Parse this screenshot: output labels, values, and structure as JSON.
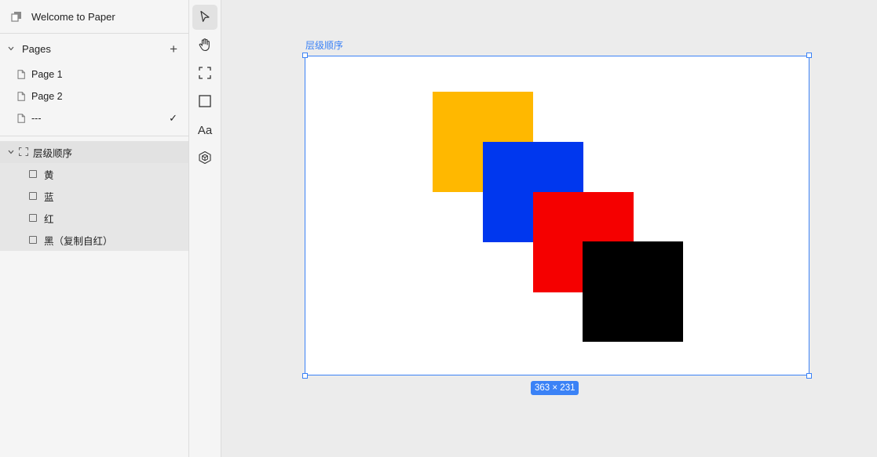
{
  "app": {
    "title": "Welcome to Paper"
  },
  "pages": {
    "header": "Pages",
    "add_icon": "plus-icon",
    "items": [
      {
        "label": "Page 1",
        "current": false
      },
      {
        "label": "Page 2",
        "current": false
      },
      {
        "label": "---",
        "current": true
      }
    ]
  },
  "layers": {
    "frame": {
      "label": "层级顺序"
    },
    "items": [
      {
        "label": "黄"
      },
      {
        "label": "蓝"
      },
      {
        "label": "红"
      },
      {
        "label": "黑（复制自红）"
      }
    ]
  },
  "toolbar": {
    "tools": [
      "pointer-icon",
      "hand-icon",
      "frame-icon",
      "rectangle-icon",
      "text-icon",
      "component-icon"
    ],
    "text_tool_label": "Aa",
    "active_tool": "pointer-icon"
  },
  "canvas": {
    "frame_label": "层级顺序",
    "size_label": "363 × 231",
    "selection_color": "#3b82f6",
    "shapes": [
      {
        "name": "黄",
        "color": "#ffb800"
      },
      {
        "name": "蓝",
        "color": "#0037ee"
      },
      {
        "name": "红",
        "color": "#f50000"
      },
      {
        "name": "黑（复制自红）",
        "color": "#000000"
      }
    ]
  }
}
